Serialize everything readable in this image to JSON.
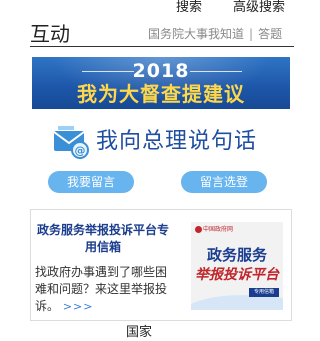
{
  "top_nav": {
    "search": "搜索",
    "advanced_search": "高级搜索"
  },
  "section": {
    "title": "互动",
    "links": [
      "国务院大事我知道",
      "答题"
    ],
    "separator": "|"
  },
  "banner": {
    "year": "2018",
    "slogan": "我为大督查提建议"
  },
  "premier_message": {
    "title": "我向总理说句话",
    "icon": "envelope-email-icon",
    "buttons": [
      "我要留言",
      "留言选登"
    ]
  },
  "platform": {
    "title": "政务服务举报投诉平台专用信箱",
    "description": "找政府办事遇到了哪些困难和问题？来这里举报投诉。",
    "more": ">>>",
    "image_text": {
      "brand": "中国政府网",
      "line1": "政务服务",
      "line2": "举报投诉平台",
      "line3": "专用信箱"
    }
  },
  "bottom": {
    "heading": "国家"
  },
  "colors": {
    "banner_blue": "#1d56a8",
    "slogan_yellow": "#ffd84a",
    "button_blue": "#67b4ef",
    "title_blue": "#1f4fa0",
    "accent_red": "#c0262b"
  }
}
